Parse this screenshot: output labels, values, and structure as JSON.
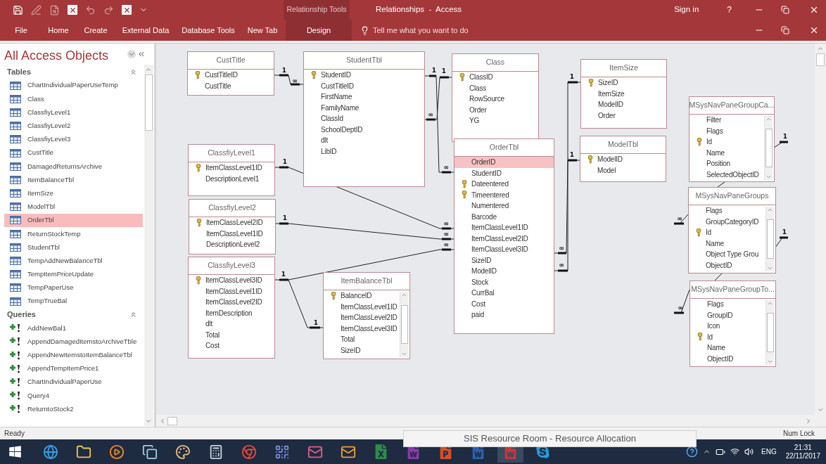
{
  "quick_access": [
    {
      "kind": "save",
      "disabled": false
    },
    {
      "kind": "edit",
      "disabled": true
    },
    {
      "kind": "preview",
      "disabled": true
    },
    {
      "kind": "close-box",
      "disabled": false
    },
    {
      "kind": "undo",
      "disabled": true
    },
    {
      "kind": "redo",
      "disabled": true
    },
    {
      "kind": "close-box",
      "disabled": false
    },
    {
      "kind": "customize",
      "disabled": false
    }
  ],
  "contextual_group": "Relationship Tools",
  "window": {
    "title": "Relationships  -  Access",
    "sign_in": "Sign in",
    "help": "?"
  },
  "ribbon_tabs": [
    {
      "label": "File",
      "selected": false
    },
    {
      "label": "Home",
      "selected": false
    },
    {
      "label": "Create",
      "selected": false
    },
    {
      "label": "External Data",
      "selected": false
    },
    {
      "label": "Database Tools",
      "selected": false
    },
    {
      "label": "New Tab",
      "selected": false
    },
    {
      "label": "Design",
      "selected": true
    }
  ],
  "tell_me": {
    "placeholder": "Tell me what you want to do"
  },
  "nav_pane": {
    "title": "All Access Objects",
    "groups": [
      {
        "title": "Tables",
        "kind": "table",
        "items": [
          {
            "label": "ChartIndividualPaperUseTemp",
            "selected": false
          },
          {
            "label": "Class",
            "selected": false
          },
          {
            "label": "ClassfiyLevel1",
            "selected": false
          },
          {
            "label": "ClassfiyLevel2",
            "selected": false
          },
          {
            "label": "ClassfiyLevel3",
            "selected": false
          },
          {
            "label": "CustTitle",
            "selected": false
          },
          {
            "label": "DamagedReturnsArchive",
            "selected": false
          },
          {
            "label": "ItemBalanceTbl",
            "selected": false
          },
          {
            "label": "ItemSize",
            "selected": false
          },
          {
            "label": "ModelTbl",
            "selected": false
          },
          {
            "label": "OrderTbl",
            "selected": true
          },
          {
            "label": "ReturnStockTemp",
            "selected": false
          },
          {
            "label": "StudentTbl",
            "selected": false
          },
          {
            "label": "TempAddNewBalanceTbl",
            "selected": false
          },
          {
            "label": "TempItemPriceUpdate",
            "selected": false
          },
          {
            "label": "TempPaperUse",
            "selected": false
          },
          {
            "label": "TempTrueBal",
            "selected": false
          }
        ]
      },
      {
        "title": "Queries",
        "kind": "query",
        "items": [
          {
            "label": "AddNewBal1",
            "selected": false
          },
          {
            "label": "AppendDamagedItemstoArchiveTble",
            "selected": false
          },
          {
            "label": "AppendNewItemstoItemBalanceTbl",
            "selected": false
          },
          {
            "label": "AppendTempItemPrice1",
            "selected": false
          },
          {
            "label": "ChartIndividualPaperUse",
            "selected": false
          },
          {
            "label": "Query4",
            "selected": false
          },
          {
            "label": "ReturntoStock2",
            "selected": false
          }
        ]
      }
    ]
  },
  "diagram": {
    "tables": [
      {
        "title": "CustTitle",
        "scrollable": false,
        "fields": [
          {
            "name": "CustTitleID",
            "key": true,
            "selected": false
          },
          {
            "name": "CustTitle",
            "key": false,
            "selected": false
          }
        ]
      },
      {
        "title": "StudentTbl",
        "scrollable": false,
        "fields": [
          {
            "name": "StudentID",
            "key": true,
            "selected": false
          },
          {
            "name": "CustTitleID",
            "key": false,
            "selected": false
          },
          {
            "name": "FirstName",
            "key": false,
            "selected": false
          },
          {
            "name": "FamilyName",
            "key": false,
            "selected": false
          },
          {
            "name": "ClassId",
            "key": false,
            "selected": false
          },
          {
            "name": "SchoolDeptID",
            "key": false,
            "selected": false
          },
          {
            "name": "dlt",
            "key": false,
            "selected": false
          },
          {
            "name": "LibID",
            "key": false,
            "selected": false
          }
        ]
      },
      {
        "title": "Class",
        "scrollable": false,
        "fields": [
          {
            "name": "ClassID",
            "key": true,
            "selected": false
          },
          {
            "name": "Class",
            "key": false,
            "selected": false
          },
          {
            "name": "RowSource",
            "key": false,
            "selected": false
          },
          {
            "name": "Order",
            "key": false,
            "selected": false
          },
          {
            "name": "YG",
            "key": false,
            "selected": false
          }
        ]
      },
      {
        "title": "ItemSize",
        "scrollable": false,
        "fields": [
          {
            "name": "SizeID",
            "key": true,
            "selected": false
          },
          {
            "name": "ItemSize",
            "key": false,
            "selected": false
          },
          {
            "name": "ModelID",
            "key": false,
            "selected": false
          },
          {
            "name": "Order",
            "key": false,
            "selected": false
          }
        ]
      },
      {
        "title": "ModelTbl",
        "scrollable": false,
        "fields": [
          {
            "name": "ModelID",
            "key": true,
            "selected": false
          },
          {
            "name": "Model",
            "key": false,
            "selected": false
          }
        ]
      },
      {
        "title": "MSysNavPaneGroupCa...",
        "scrollable": true,
        "fields": [
          {
            "name": "Filter",
            "key": false,
            "selected": false
          },
          {
            "name": "Flags",
            "key": false,
            "selected": false
          },
          {
            "name": "Id",
            "key": true,
            "selected": false
          },
          {
            "name": "Name",
            "key": false,
            "selected": false
          },
          {
            "name": "Position",
            "key": false,
            "selected": false
          },
          {
            "name": "SelectedObjectID",
            "key": false,
            "selected": false
          }
        ]
      },
      {
        "title": "ClassfiyLevel1",
        "scrollable": false,
        "fields": [
          {
            "name": "ItemClassLevel1ID",
            "key": true,
            "selected": false
          },
          {
            "name": "DescriptionLevel1",
            "key": false,
            "selected": false
          }
        ]
      },
      {
        "title": "OrderTbl",
        "scrollable": false,
        "fields": [
          {
            "name": "OrderID",
            "key": false,
            "selected": true
          },
          {
            "name": "StudentID",
            "key": false,
            "selected": false
          },
          {
            "name": "Dateentered",
            "key": true,
            "selected": false
          },
          {
            "name": "Timeentered",
            "key": true,
            "selected": false
          },
          {
            "name": "Numentered",
            "key": false,
            "selected": false
          },
          {
            "name": "Barcode",
            "key": false,
            "selected": false
          },
          {
            "name": "ItemClassLevel1ID",
            "key": false,
            "selected": false
          },
          {
            "name": "ItemClassLevel2ID",
            "key": false,
            "selected": false
          },
          {
            "name": "ItemClassLevel3ID",
            "key": false,
            "selected": false
          },
          {
            "name": "SizeID",
            "key": false,
            "selected": false
          },
          {
            "name": "ModelID",
            "key": false,
            "selected": false
          },
          {
            "name": "Stock",
            "key": false,
            "selected": false
          },
          {
            "name": "CurrBal",
            "key": false,
            "selected": false
          },
          {
            "name": "Cost",
            "key": false,
            "selected": false
          },
          {
            "name": "paid",
            "key": false,
            "selected": false
          }
        ]
      },
      {
        "title": "ClassfiyLevel2",
        "scrollable": false,
        "fields": [
          {
            "name": "ItemClassLevel2ID",
            "key": true,
            "selected": false
          },
          {
            "name": "ItemClassLevel1ID",
            "key": false,
            "selected": false
          },
          {
            "name": "DescriptionLevel2",
            "key": false,
            "selected": false
          }
        ]
      },
      {
        "title": "MSysNavPaneGroups",
        "scrollable": true,
        "fields": [
          {
            "name": "Flags",
            "key": false,
            "selected": false
          },
          {
            "name": "GroupCategoryID",
            "key": false,
            "selected": false
          },
          {
            "name": "Id",
            "key": true,
            "selected": false
          },
          {
            "name": "Name",
            "key": false,
            "selected": false
          },
          {
            "name": "Object Type Grou",
            "key": false,
            "selected": false
          },
          {
            "name": "ObjectID",
            "key": false,
            "selected": false
          }
        ]
      },
      {
        "title": "ClassfiyLevel3",
        "scrollable": false,
        "fields": [
          {
            "name": "ItemClassLevel3ID",
            "key": true,
            "selected": false
          },
          {
            "name": "ItemClassLevel1ID",
            "key": false,
            "selected": false
          },
          {
            "name": "ItemClassLevel2ID",
            "key": false,
            "selected": false
          },
          {
            "name": "ItemDescription",
            "key": false,
            "selected": false
          },
          {
            "name": "dlt",
            "key": false,
            "selected": false
          },
          {
            "name": "Total",
            "key": false,
            "selected": false
          },
          {
            "name": "Cost",
            "key": false,
            "selected": false
          }
        ]
      },
      {
        "title": "ItemBalanceTbl",
        "scrollable": true,
        "fields": [
          {
            "name": "BalanceID",
            "key": true,
            "selected": false
          },
          {
            "name": "ItemClassLevel1ID",
            "key": false,
            "selected": false
          },
          {
            "name": "ItemClassLevel2ID",
            "key": false,
            "selected": false
          },
          {
            "name": "ItemClassLevel3ID",
            "key": false,
            "selected": false
          },
          {
            "name": "Total",
            "key": false,
            "selected": false
          },
          {
            "name": "SizeID",
            "key": false,
            "selected": false
          }
        ]
      },
      {
        "title": "MSysNavPaneGroupTo...",
        "scrollable": true,
        "fields": [
          {
            "name": "Flags",
            "key": false,
            "selected": false
          },
          {
            "name": "GroupID",
            "key": false,
            "selected": false
          },
          {
            "name": "Icon",
            "key": false,
            "selected": false
          },
          {
            "name": "Id",
            "key": true,
            "selected": false
          },
          {
            "name": "Name",
            "key": false,
            "selected": false
          },
          {
            "name": "ObjectID",
            "key": false,
            "selected": false
          }
        ]
      }
    ],
    "relationships": [
      {
        "labels": [
          "1",
          "∞"
        ]
      },
      {
        "labels": [
          "1",
          "∞"
        ]
      },
      {
        "labels": [
          "1",
          "∞"
        ]
      },
      {
        "labels": [
          "1",
          "∞"
        ]
      },
      {
        "labels": [
          "1",
          "∞"
        ]
      },
      {
        "labels": [
          "1",
          "∞"
        ]
      },
      {
        "labels": [
          "1"
        ]
      },
      {
        "labels": [
          "1",
          "∞"
        ]
      },
      {
        "labels": [
          "1",
          "∞"
        ]
      },
      {
        "labels": [
          "1",
          "∞"
        ]
      },
      {
        "labels": [
          "1",
          "∞"
        ]
      }
    ]
  },
  "status_bar": {
    "left": "Ready",
    "right": "Num Lock"
  },
  "taskbar": {
    "tooltip": "SIS Resource Room - Resource Allocation",
    "language": "ENG",
    "time": "21:31",
    "date": "22/11/2017"
  }
}
